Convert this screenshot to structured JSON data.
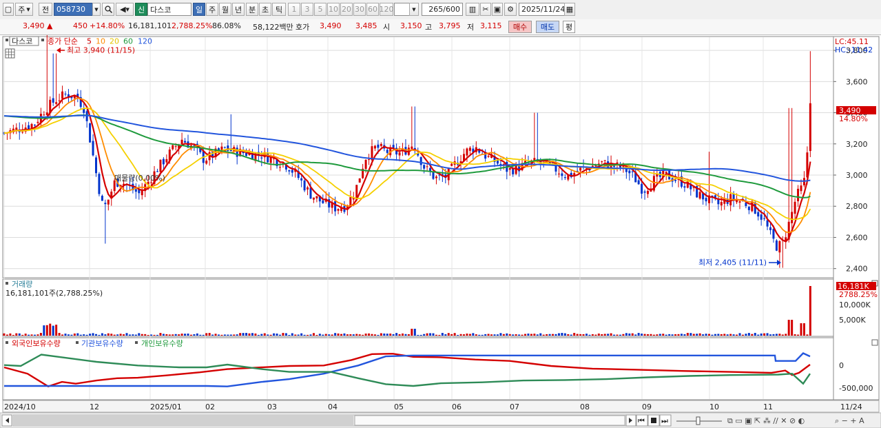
{
  "toolbar": {
    "period_type": "주",
    "prev_label": "전",
    "code": "058730",
    "new_badge": "신",
    "stock_name": "다스코",
    "periods": [
      "일",
      "주",
      "월",
      "년",
      "분",
      "초",
      "틱"
    ],
    "active_period": "일",
    "intervals": [
      "1",
      "3",
      "5",
      "10",
      "20",
      "30",
      "60",
      "120"
    ],
    "count": "265",
    "count_max": "/600",
    "date": "2025/11/24"
  },
  "quote": {
    "price": "3,490",
    "change": "450",
    "change_pct": "+14.80%",
    "volume": "16,181,101",
    "volume_ratio": "2,788.25%",
    "turnover": "86.08%",
    "amount": "58,122백만",
    "ask_label": "호가",
    "ask": "3,490",
    "bid": "3,485",
    "open_label": "시",
    "open": "3,150",
    "high_label": "고",
    "high": "3,795",
    "low_label": "저",
    "low": "3,115",
    "buy_label": "매수",
    "sell_label": "매도",
    "eval_label": "평"
  },
  "price_panel": {
    "name_tag": "다스코",
    "legend_prefix": "종가 단순",
    "ma_labels": [
      "5",
      "10",
      "20",
      "60",
      "120"
    ],
    "ma_colors": [
      "#d40000",
      "#ff8c00",
      "#ffd700",
      "#1e9a3c",
      "#2255dd"
    ],
    "lc": "LC:45.11",
    "hc": "HC:-11.42",
    "max_annot": "최고 3,940 (11/15)",
    "min_annot": "최저 2,405 (11/11)",
    "mid_annot": "매물량(0.00%)",
    "cur_price": "3,490",
    "cur_pct": "14.80%",
    "yticks": [
      "3,800",
      "3,600",
      "3,400",
      "3,200",
      "3,000",
      "2,800",
      "2,600",
      "2,400"
    ]
  },
  "volume_panel": {
    "title": "거래량",
    "info": "16,181,101주(2,788.25%)",
    "cur": "16,181K",
    "cur_pct": "2788.25%",
    "yticks": [
      "10,000K",
      "5,000K"
    ]
  },
  "holding_panel": {
    "labels": [
      "외국인보유수량",
      "기관보유수량",
      "개인보유수량"
    ],
    "colors": [
      "#d40000",
      "#2255dd",
      "#1e9a3c"
    ],
    "yticks": [
      "0",
      "-500,000"
    ]
  },
  "xaxis": {
    "labels": [
      "2024/10",
      "12",
      "2025/01",
      "02",
      "03",
      "04",
      "05",
      "06",
      "07",
      "08",
      "09",
      "10",
      "11"
    ],
    "right_date": "11/24"
  },
  "colors": {
    "up": "#d40000",
    "down": "#0033cc",
    "grid": "#d8d8d8"
  },
  "chart_data": {
    "type": "candlestick",
    "x_range": [
      "2024/10",
      "2025/11/24"
    ],
    "ylim": [
      2350,
      3880
    ],
    "series": [
      {
        "name": "5",
        "values": [
          3250,
          3420,
          3500,
          3430,
          2800,
          2900,
          3200,
          3150,
          3250,
          3100,
          3300,
          3150,
          2950,
          3000,
          3150,
          2950,
          3050,
          3100,
          3000,
          3050,
          3050,
          3000,
          2950,
          2850,
          2820,
          2730,
          3150,
          3100,
          2950,
          3150,
          3200,
          3080,
          3050,
          3040,
          3090,
          3050,
          3020,
          2950,
          2950,
          2900,
          2800,
          2700,
          2550,
          2650,
          2900,
          3490
        ]
      },
      {
        "name": "120",
        "values": [
          3350,
          3350,
          3340,
          3340,
          3320,
          3280,
          3230,
          3210,
          3200,
          3180,
          3150,
          3130,
          3100,
          3080,
          3060,
          3050,
          3040,
          3050,
          3060,
          3070,
          3080,
          3080,
          3070,
          3050,
          3030,
          3000,
          2980,
          2960,
          2960
        ]
      }
    ],
    "range_text": {
      "max": "최고 3,940 (11/15)",
      "min": "최저 2,405 (11/11)"
    }
  }
}
